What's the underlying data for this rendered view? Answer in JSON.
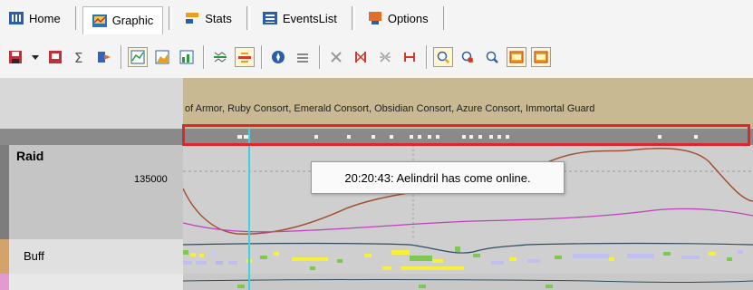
{
  "tabs": [
    {
      "label": "Home",
      "icon": "home-icon"
    },
    {
      "label": "Graphic",
      "icon": "graphic-icon",
      "active": true
    },
    {
      "label": "Stats",
      "icon": "stats-icon"
    },
    {
      "label": "EventsList",
      "icon": "eventslist-icon"
    },
    {
      "label": "Options",
      "icon": "options-icon"
    }
  ],
  "events_text": "of Armor, Ruby Consort, Emerald Consort, Obsidian Consort, Azure Consort, Immortal Guard",
  "rows": {
    "raid": {
      "label": "Raid",
      "value": "135000"
    },
    "buff": {
      "label": "Buff"
    }
  },
  "tooltip": "20:20:43: Aelindril has come online.",
  "colors": {
    "highlight": "#e0262d",
    "cursor": "#3ad4e0",
    "raid_line": "#a0522d",
    "magenta_line": "#c040c0"
  }
}
